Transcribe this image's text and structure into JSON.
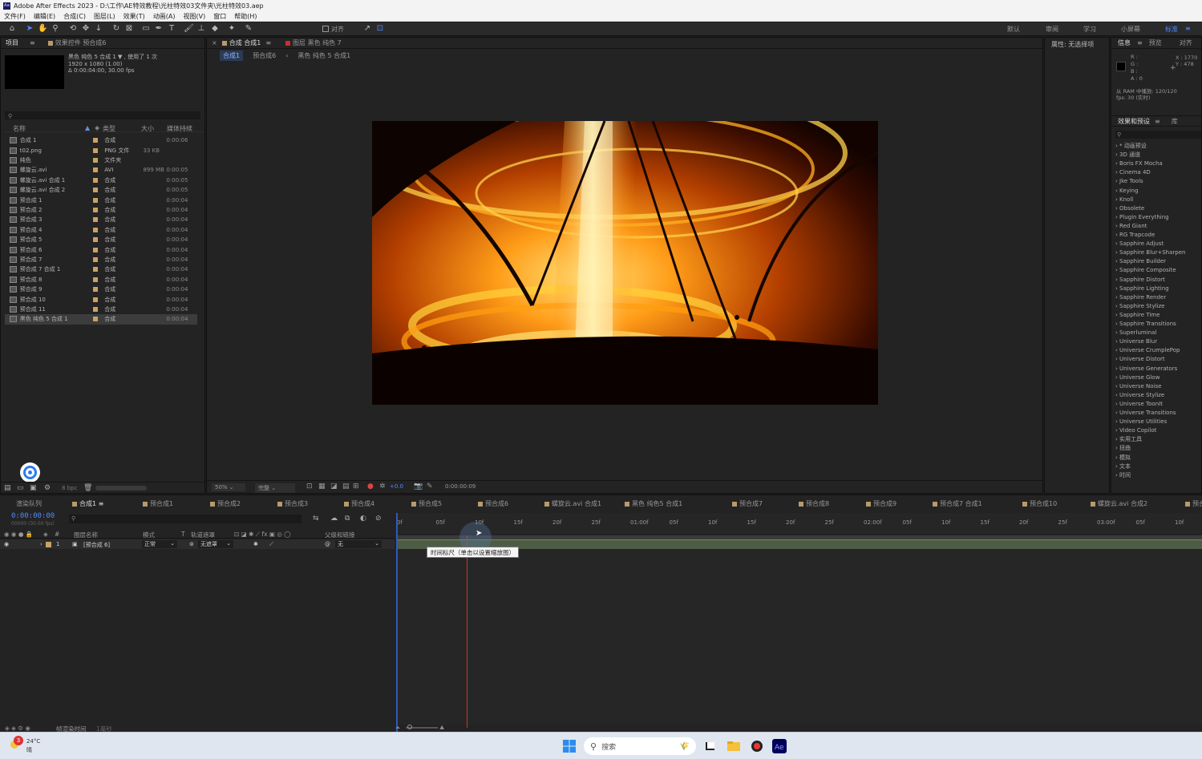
{
  "window": {
    "title": "Adobe After Effects 2023 - D:\\工作\\AE特效教程\\光柱特效03文件夹\\光柱特效03.aep"
  },
  "menu": [
    "文件(F)",
    "编辑(E)",
    "合成(C)",
    "图层(L)",
    "效果(T)",
    "动画(A)",
    "视图(V)",
    "窗口",
    "帮助(H)"
  ],
  "toolbar": {
    "snap_label": "对齐",
    "workspaces": [
      "默认",
      "审阅",
      "学习",
      "小屏幕",
      "标准"
    ]
  },
  "project": {
    "tab": "项目",
    "effects_tab": "效果控件 预合成6",
    "info_lines": [
      "黑色 纯色 5 合成 1 ▼ , 使用了 1 次",
      "1920 x 1080 (1.00)",
      "Δ 0:00:04:00, 30.00 fps"
    ],
    "columns": [
      "名称",
      "类型",
      "大小",
      "媒体持续"
    ],
    "items": [
      {
        "name": "合成 1",
        "type": "合成",
        "size": "",
        "dur": "0:00:06"
      },
      {
        "name": "t02.png",
        "type": "PNG 文件",
        "size": "33 KB",
        "dur": ""
      },
      {
        "name": "纯色",
        "type": "文件夹",
        "size": "",
        "dur": ""
      },
      {
        "name": "螺旋云.avi",
        "type": "AVI",
        "size": "899 MB",
        "dur": "0:00:05"
      },
      {
        "name": "螺旋云.avi 合成 1",
        "type": "合成",
        "size": "",
        "dur": "0:00:05"
      },
      {
        "name": "螺旋云.avi 合成 2",
        "type": "合成",
        "size": "",
        "dur": "0:00:05"
      },
      {
        "name": "预合成 1",
        "type": "合成",
        "size": "",
        "dur": "0:00:04"
      },
      {
        "name": "预合成 2",
        "type": "合成",
        "size": "",
        "dur": "0:00:04"
      },
      {
        "name": "预合成 3",
        "type": "合成",
        "size": "",
        "dur": "0:00:04"
      },
      {
        "name": "预合成 4",
        "type": "合成",
        "size": "",
        "dur": "0:00:04"
      },
      {
        "name": "预合成 5",
        "type": "合成",
        "size": "",
        "dur": "0:00:04"
      },
      {
        "name": "预合成 6",
        "type": "合成",
        "size": "",
        "dur": "0:00:04"
      },
      {
        "name": "预合成 7",
        "type": "合成",
        "size": "",
        "dur": "0:00:04"
      },
      {
        "name": "预合成 7 合成 1",
        "type": "合成",
        "size": "",
        "dur": "0:00:04"
      },
      {
        "name": "预合成 8",
        "type": "合成",
        "size": "",
        "dur": "0:00:04"
      },
      {
        "name": "预合成 9",
        "type": "合成",
        "size": "",
        "dur": "0:00:04"
      },
      {
        "name": "预合成 10",
        "type": "合成",
        "size": "",
        "dur": "0:00:04"
      },
      {
        "name": "预合成 11",
        "type": "合成",
        "size": "",
        "dur": "0:00:04"
      },
      {
        "name": "黑色 纯色 5 合成 1",
        "type": "合成",
        "size": "",
        "dur": "0:00:04"
      }
    ],
    "bpc": "8 bpc"
  },
  "viewer": {
    "tab_comp": "合成 合成1",
    "tab_layer": "图层 黑色 纯色 7",
    "breadcrumbs": [
      "合成1",
      "预合成6",
      "黑色 纯色 5 合成1"
    ],
    "zoom": "50%",
    "quality": "完整",
    "exposure": "+0.0",
    "timecode": "0:00:00:09"
  },
  "props": {
    "title": "属性: 无选择项"
  },
  "info_panel": {
    "tabs": [
      "信息",
      "预览",
      "对齐"
    ],
    "rgba": [
      "R :",
      "G :",
      "B :",
      "A : 0"
    ],
    "xy": [
      "X : 1770",
      "Y : 478"
    ],
    "ram": "从 RAM 中播放: 120/120",
    "fps": "fps: 30 (实时)"
  },
  "effects_panel": {
    "tabs": [
      "效果和预设",
      "库"
    ],
    "items": [
      "* 动画预设",
      "3D 通道",
      "Boris FX Mocha",
      "Cinema 4D",
      "Jke Tools",
      "Keying",
      "Knoll",
      "Obsolete",
      "Plugin Everything",
      "Red Giant",
      "RG Trapcode",
      "Sapphire Adjust",
      "Sapphire Blur+Sharpen",
      "Sapphire Builder",
      "Sapphire Composite",
      "Sapphire Distort",
      "Sapphire Lighting",
      "Sapphire Render",
      "Sapphire Stylize",
      "Sapphire Time",
      "Sapphire Transitions",
      "Superluminal",
      "Universe Blur",
      "Universe CrumplePop",
      "Universe Distort",
      "Universe Generators",
      "Universe Glow",
      "Universe Noise",
      "Universe Stylize",
      "Universe ToonIt",
      "Universe Transitions",
      "Universe Utilities",
      "Video Copilot",
      "实用工具",
      "扭曲",
      "模拟",
      "文本",
      "时间"
    ]
  },
  "timeline": {
    "tabs": [
      "渲染队列",
      "合成1",
      "预合成1",
      "预合成2",
      "预合成3",
      "预合成4",
      "预合成5",
      "预合成6",
      "螺旋云.avi 合成1",
      "黑色 纯色5 合成1",
      "预合成7",
      "预合成8",
      "预合成9",
      "预合成7 合成1",
      "预合成10",
      "螺旋云.avi 合成2",
      "预合成"
    ],
    "timecode": "0:00:00:00",
    "timecode_sub": "00000 (30.00 fps)",
    "columns": [
      "图层名称",
      "模式",
      "T",
      "轨道遮罩",
      "父级和链接"
    ],
    "layer": {
      "index": "1",
      "name": "[预合成 6]",
      "mode": "正常",
      "matte": "无遮罩",
      "parent": "无"
    },
    "ruler": [
      "0f",
      "05f",
      "10f",
      "15f",
      "20f",
      "25f",
      "01:00f",
      "05f",
      "10f",
      "15f",
      "20f",
      "25f",
      "02:00f",
      "05f",
      "10f",
      "15f",
      "20f",
      "25f",
      "03:00f",
      "05f",
      "10f"
    ],
    "tooltip": "时间标尺（单击以设置缩放图）",
    "footer": "帧渲染时间",
    "footer_ms": "1毫秒"
  },
  "taskbar": {
    "weather_temp": "24°C",
    "weather_desc": "晴",
    "search": "搜索",
    "badge": "3"
  }
}
